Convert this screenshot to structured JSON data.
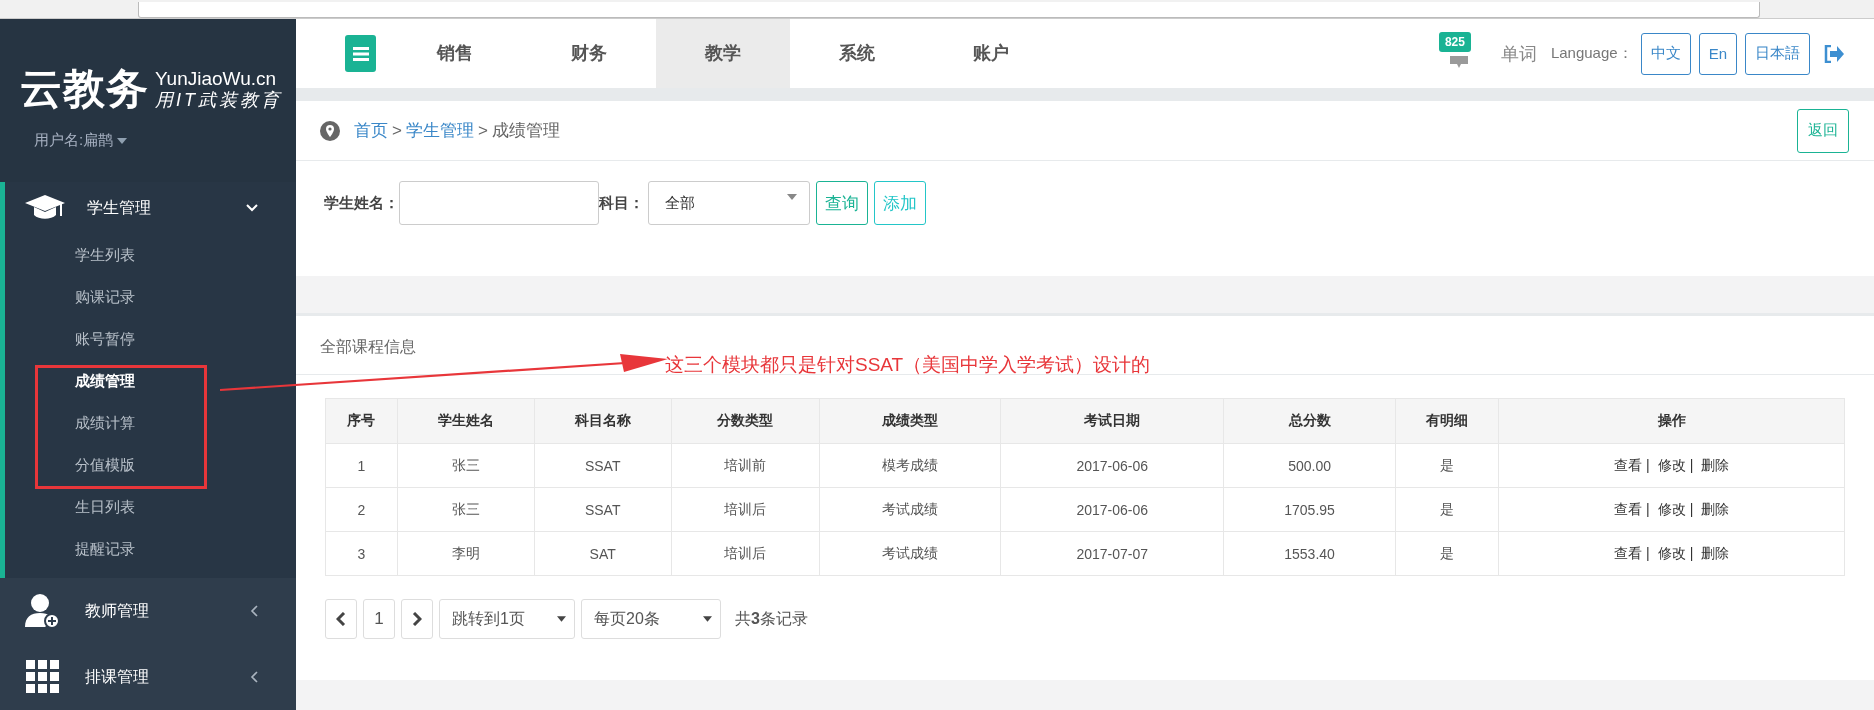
{
  "sidebar": {
    "logo": "云教务",
    "logo_domain": "YunJiaoWu.cn",
    "slogan": "用IT武装教育",
    "user": "用户名:扁鹊",
    "menu": [
      {
        "label": "学生管理",
        "kind": "students",
        "expanded": true,
        "children": [
          {
            "label": "学生列表",
            "selected": false
          },
          {
            "label": "购课记录",
            "selected": false
          },
          {
            "label": "账号暂停",
            "selected": false
          },
          {
            "label": "成绩管理",
            "selected": true
          },
          {
            "label": "成绩计算",
            "selected": false
          },
          {
            "label": "分值模版",
            "selected": false
          },
          {
            "label": "生日列表",
            "selected": false
          },
          {
            "label": "提醒记录",
            "selected": false
          }
        ]
      },
      {
        "label": "教师管理",
        "kind": "teachers",
        "expanded": false
      },
      {
        "label": "排课管理",
        "kind": "schedule",
        "expanded": false
      }
    ]
  },
  "topnav": {
    "tabs": [
      {
        "label": "销售",
        "selected": false
      },
      {
        "label": "财务",
        "selected": false
      },
      {
        "label": "教学",
        "selected": true
      },
      {
        "label": "系统",
        "selected": false
      },
      {
        "label": "账户",
        "selected": false
      }
    ],
    "badge": "825",
    "words": "单词",
    "language_label": "Language：",
    "languages": [
      "中文",
      "En",
      "日本語"
    ]
  },
  "breadcrumb": {
    "items": [
      {
        "label": "首页",
        "kind": "link"
      },
      {
        "label": ">",
        "kind": "separator"
      },
      {
        "label": "学生管理",
        "kind": "link"
      },
      {
        "label": ">",
        "kind": "separator"
      },
      {
        "label": "成绩管理",
        "kind": "current"
      }
    ],
    "back_button": "返回"
  },
  "filter": {
    "name_label": "学生姓名：",
    "subject_label": "科目：",
    "subject_value": "全部",
    "buttons": [
      {
        "label": "查询",
        "kind": "primary"
      },
      {
        "label": "添加",
        "kind": "info"
      }
    ]
  },
  "table": {
    "title": "全部课程信息",
    "columns": [
      "序号",
      "学生姓名",
      "科目名称",
      "分数类型",
      "成绩类型",
      "考试日期",
      "总分数",
      "有明细",
      "操作"
    ],
    "rows": [
      {
        "cells": [
          "1",
          "张三",
          "SSAT",
          "培训前",
          "模考成绩",
          "2017-06-06",
          "500.00",
          "是"
        ],
        "actions": [
          {
            "label": "查看",
            "separator": "|"
          },
          {
            "label": "修改",
            "separator": "|"
          },
          {
            "label": "删除"
          }
        ]
      },
      {
        "cells": [
          "2",
          "张三",
          "SSAT",
          "培训后",
          "考试成绩",
          "2017-06-06",
          "1705.95",
          "是"
        ],
        "actions": [
          {
            "label": "查看",
            "separator": "|"
          },
          {
            "label": "修改",
            "separator": "|"
          },
          {
            "label": "删除"
          }
        ]
      },
      {
        "cells": [
          "3",
          "李明",
          "SAT",
          "培训后",
          "考试成绩",
          "2017-07-07",
          "1553.40",
          "是"
        ],
        "actions": [
          {
            "label": "查看",
            "separator": "|"
          },
          {
            "label": "修改",
            "separator": "|"
          },
          {
            "label": "删除"
          }
        ]
      }
    ]
  },
  "pagination": {
    "page": "1",
    "jump": "跳转到1页",
    "per_page": "每页20条",
    "total": "共**3**条记录"
  },
  "annotation": {
    "text": "这三个模块都只是针对SSAT（美国中学入学考试）设计的"
  }
}
